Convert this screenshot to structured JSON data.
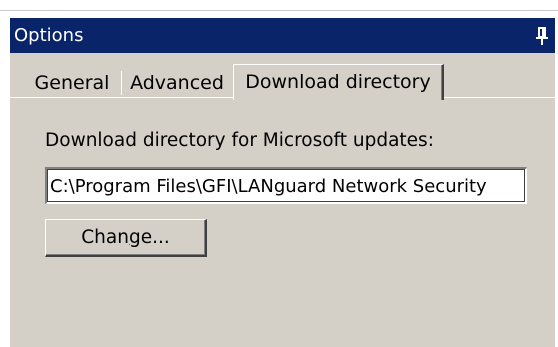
{
  "window": {
    "title": "Options",
    "pin_icon": "pin-icon"
  },
  "tabs": [
    {
      "label": "General",
      "active": false
    },
    {
      "label": "Advanced",
      "active": false
    },
    {
      "label": "Download directory",
      "active": true
    }
  ],
  "download": {
    "label": "Download directory for Microsoft updates:",
    "path_value": "C:\\Program Files\\GFI\\LANguard Network Security",
    "change_label_pre": "Chan",
    "change_label_mnemonic": "g",
    "change_label_post": "e..."
  },
  "colors": {
    "titlebar": "#0a246a",
    "panel": "#d4d0c8",
    "field": "#ffffff"
  }
}
